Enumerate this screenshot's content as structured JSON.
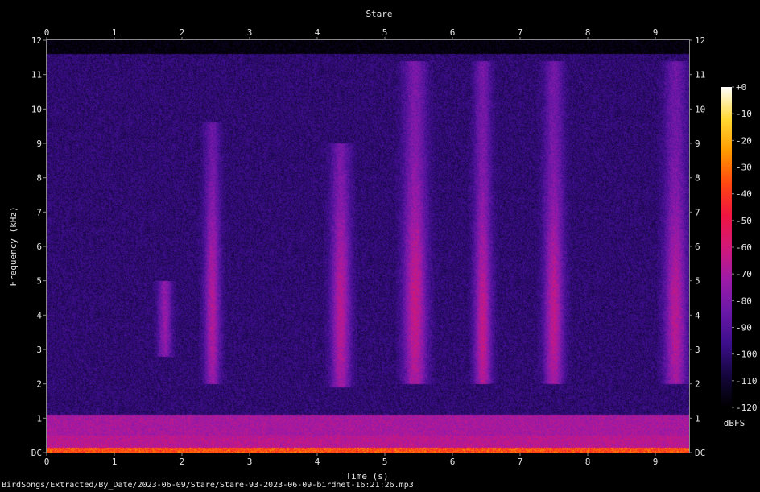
{
  "chart_data": {
    "type": "heatmap",
    "title": "Stare",
    "xlabel": "Time (s)",
    "ylabel": "Frequency (kHz)",
    "xlim": [
      0,
      9.5
    ],
    "ylim": [
      0,
      12
    ],
    "x_ticks": [
      "0",
      "1",
      "2",
      "3",
      "4",
      "5",
      "6",
      "7",
      "8",
      "9"
    ],
    "y_ticks": [
      "DC",
      "1",
      "2",
      "3",
      "4",
      "5",
      "6",
      "7",
      "8",
      "9",
      "10",
      "11",
      "12"
    ],
    "colorbar": {
      "label": "dBFS",
      "range": [
        -120,
        0
      ],
      "ticks": [
        "+0",
        "-10",
        "-20",
        "-30",
        "-40",
        "-50",
        "-60",
        "-70",
        "-80",
        "-90",
        "-100",
        "-110",
        "-120"
      ],
      "colors": [
        "#000000",
        "#14063c",
        "#3c0e8c",
        "#6a18a8",
        "#9e1aa8",
        "#d21878",
        "#f01440",
        "#ff4810",
        "#ff9a00",
        "#ffd832",
        "#ffffff"
      ]
    },
    "background_level_dbfs": -100,
    "low_freq_band": {
      "f_max_khz": 1.1,
      "level_dbfs": -70
    },
    "dc_band": {
      "f_max_khz": 0.15,
      "level_dbfs": -35
    },
    "signal_cutoff_khz": 11.6,
    "calls": [
      {
        "t": 1.75,
        "width": 0.18,
        "f_low": 2.8,
        "f_high": 5.0,
        "peak_freq": 4.0,
        "level_dbfs": -75
      },
      {
        "t": 2.45,
        "width": 0.2,
        "f_low": 2.0,
        "f_high": 9.6,
        "peak_freq": 4.2,
        "level_dbfs": -68
      },
      {
        "t": 4.35,
        "width": 0.25,
        "f_low": 1.9,
        "f_high": 9.0,
        "peak_freq": 4.0,
        "level_dbfs": -66
      },
      {
        "t": 5.45,
        "width": 0.3,
        "f_low": 2.0,
        "f_high": 11.4,
        "peak_freq": 4.2,
        "level_dbfs": -63
      },
      {
        "t": 6.45,
        "width": 0.22,
        "f_low": 2.0,
        "f_high": 11.4,
        "peak_freq": 3.6,
        "level_dbfs": -64
      },
      {
        "t": 7.5,
        "width": 0.25,
        "f_low": 2.0,
        "f_high": 11.4,
        "peak_freq": 4.0,
        "level_dbfs": -65
      },
      {
        "t": 9.3,
        "width": 0.28,
        "f_low": 2.0,
        "f_high": 11.4,
        "peak_freq": 4.0,
        "level_dbfs": -66
      }
    ]
  },
  "footer": "BirdSongs/Extracted/By_Date/2023-06-09/Stare/Stare-93-2023-06-09-birdnet-16:21:26.mp3"
}
